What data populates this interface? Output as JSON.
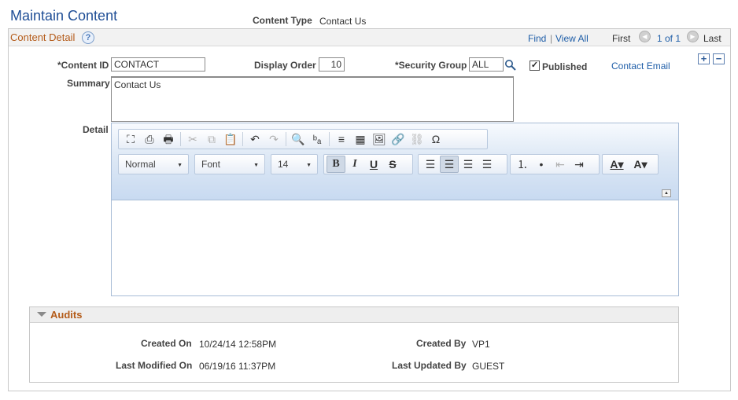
{
  "page": {
    "title": "Maintain Content"
  },
  "header": {
    "content_type_label": "Content Type",
    "content_type_value": "Contact Us"
  },
  "section": {
    "title": "Content Detail",
    "help_icon": "?",
    "nav": {
      "find": "Find",
      "separator": "|",
      "view_all": "View All",
      "first": "First",
      "counter": "1 of 1",
      "last": "Last"
    }
  },
  "form": {
    "content_id": {
      "label": "*Content ID",
      "value": "CONTACT"
    },
    "display_order": {
      "label": "Display Order",
      "value": "10"
    },
    "security_group": {
      "label": "*Security Group",
      "value": "ALL"
    },
    "published": {
      "label": "Published",
      "checked": true,
      "check_glyph": "✓"
    },
    "contact_email_link": "Contact Email",
    "add_row": "+",
    "delete_row": "−",
    "summary": {
      "label": "Summary",
      "value": "Contact Us"
    },
    "detail": {
      "label": "Detail"
    }
  },
  "editor": {
    "toolbar_row1": [
      {
        "icon": "maximize-icon",
        "glyph": "⛶"
      },
      {
        "icon": "preview-icon",
        "glyph": "⎙"
      },
      {
        "icon": "print-icon",
        "glyph": "🖶"
      },
      {
        "icon": "cut-icon",
        "glyph": "✂",
        "disabled": true
      },
      {
        "icon": "copy-icon",
        "glyph": "⧉",
        "disabled": true
      },
      {
        "icon": "paste-icon",
        "glyph": "📋"
      },
      {
        "icon": "undo-icon",
        "glyph": "↶"
      },
      {
        "icon": "redo-icon",
        "glyph": "↷",
        "disabled": true
      },
      {
        "icon": "find-icon",
        "glyph": "🔍"
      },
      {
        "icon": "replace-icon",
        "glyph": "ᵇₐ"
      },
      {
        "icon": "horizontal-rule-icon",
        "glyph": "≡"
      },
      {
        "icon": "table-icon",
        "glyph": "▦"
      },
      {
        "icon": "image-icon",
        "glyph": "🖼"
      },
      {
        "icon": "link-icon",
        "glyph": "🔗"
      },
      {
        "icon": "unlink-icon",
        "glyph": "⛓",
        "disabled": true
      },
      {
        "icon": "special-char-icon",
        "glyph": "Ω"
      }
    ],
    "format_combo": "Normal",
    "font_combo": "Font",
    "size_combo": "14",
    "combo_caret": "▼",
    "style_buttons": [
      {
        "icon": "bold-icon",
        "glyph": "B",
        "active": true
      },
      {
        "icon": "italic-icon",
        "glyph": "I"
      },
      {
        "icon": "underline-icon",
        "glyph": "U"
      },
      {
        "icon": "strikethrough-icon",
        "glyph": "S"
      }
    ],
    "align_buttons": [
      {
        "icon": "align-left-icon",
        "glyph": "☰"
      },
      {
        "icon": "align-center-icon",
        "glyph": "☰",
        "active": true
      },
      {
        "icon": "align-right-icon",
        "glyph": "☰"
      },
      {
        "icon": "justify-icon",
        "glyph": "☰"
      }
    ],
    "list_buttons": [
      {
        "icon": "numbered-list-icon",
        "glyph": "⒈"
      },
      {
        "icon": "bulleted-list-icon",
        "glyph": "•"
      },
      {
        "icon": "outdent-icon",
        "glyph": "⇤",
        "disabled": true
      },
      {
        "icon": "indent-icon",
        "glyph": "⇥"
      }
    ],
    "color_buttons": [
      {
        "icon": "text-color-icon",
        "glyph": "A▾"
      },
      {
        "icon": "bg-color-icon",
        "glyph": "A▾"
      }
    ],
    "collapse_glyph": "▲",
    "body": ""
  },
  "audits": {
    "title": "Audits",
    "created_on": {
      "label": "Created On",
      "value": "10/24/14 12:58PM"
    },
    "last_modified_on": {
      "label": "Last Modified On",
      "value": "06/19/16 11:37PM"
    },
    "created_by": {
      "label": "Created By",
      "value": "VP1"
    },
    "last_updated_by": {
      "label": "Last Updated By",
      "value": "GUEST"
    }
  },
  "colors": {
    "title_blue": "#1f4e96",
    "section_orange": "#b45b19",
    "link_blue": "#1f5ea8"
  }
}
